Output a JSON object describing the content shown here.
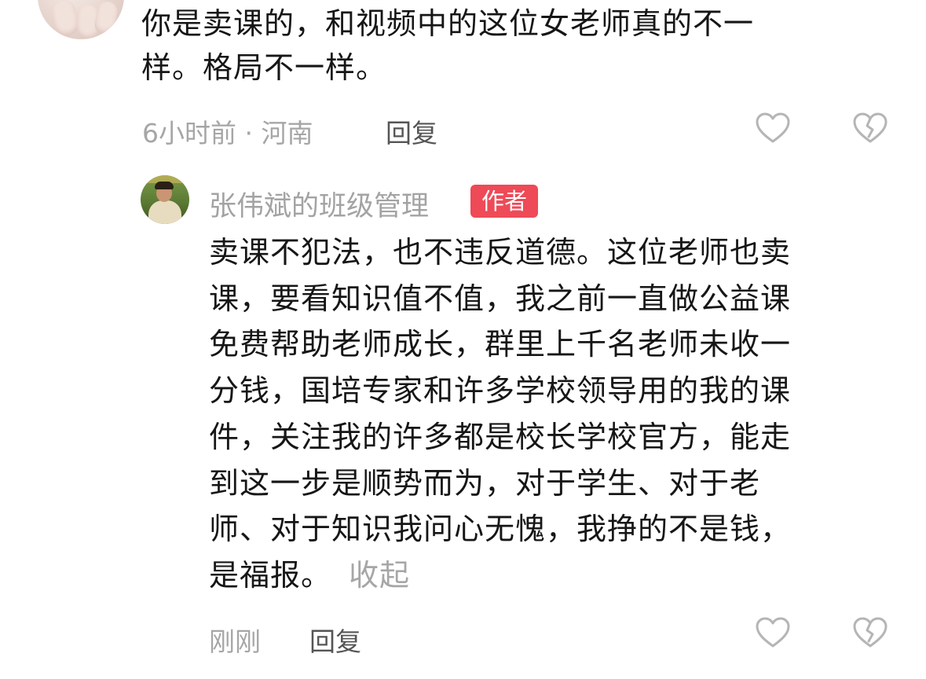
{
  "top_comment": {
    "text_lines": [
      "你是卖课的，和视频中的这位女老师真的不一",
      "样。格局不一样。"
    ],
    "meta": "6小时前 · 河南",
    "reply_label": "回复"
  },
  "author_reply": {
    "username": "张伟斌的班级管理",
    "badge": "作者",
    "text_lines": [
      "卖课不犯法，也不违反道德。这位老师也卖",
      "课，要看知识值不值，我之前一直做公益课",
      "免费帮助老师成长，群里上千名老师未收一",
      "分钱，国培专家和许多学校领导用的我的课",
      "件，关注我的许多都是校长学校官方，能走",
      "到这一步是顺势而为，对于学生、对于老",
      "师、对于知识我问心无愧，我挣的不是钱，",
      "是福报。"
    ],
    "collapse_label": "收起",
    "meta": "刚刚",
    "reply_label": "回复"
  },
  "colors": {
    "badge": "#ee4a57",
    "meta_text": "#a6a6a6",
    "icon_stroke": "#b5b5b5"
  }
}
